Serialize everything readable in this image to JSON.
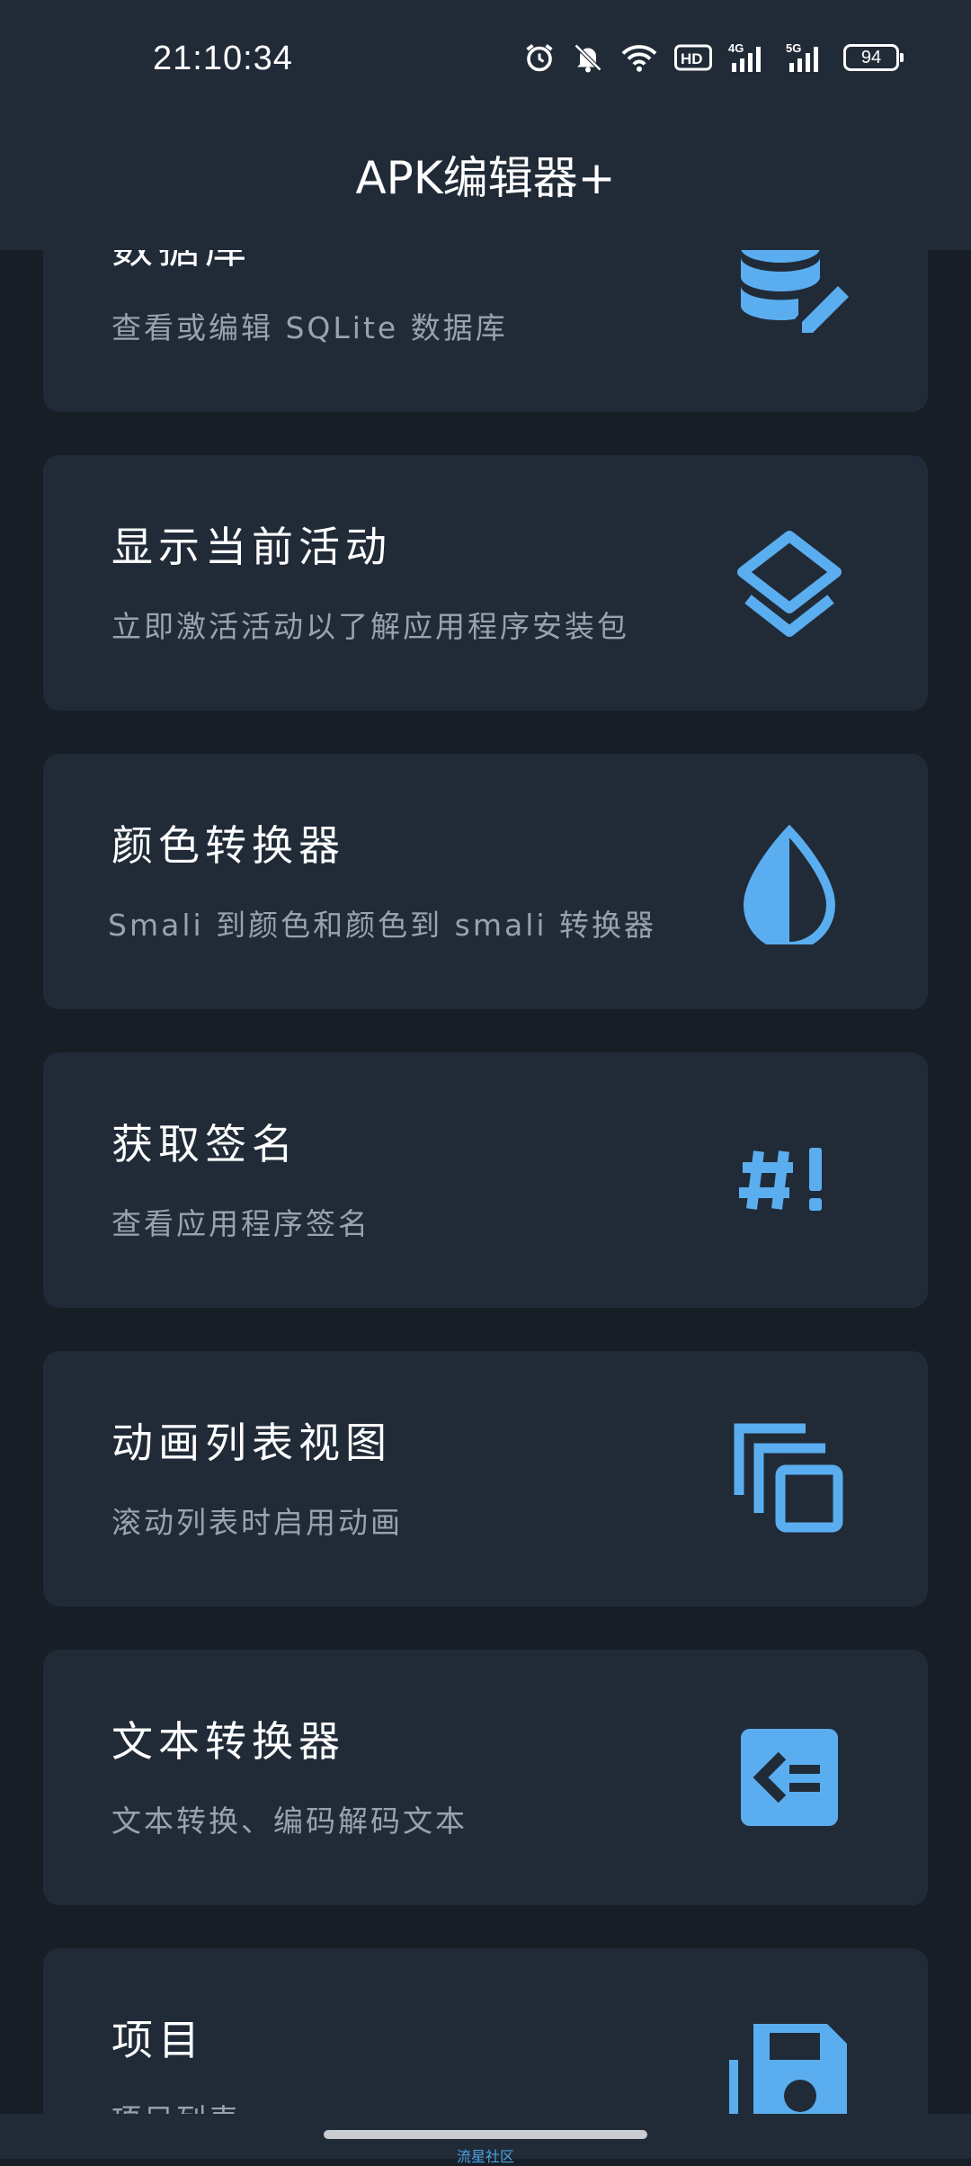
{
  "status_bar": {
    "time": "21:10:34",
    "battery": "94",
    "network_1": "4G",
    "network_2": "5G",
    "hd": "HD"
  },
  "app_bar": {
    "title": "APK编辑器+"
  },
  "colors": {
    "accent": "#5aaef0",
    "card_bg": "#212b38",
    "page_bg": "#181e26"
  },
  "cards": [
    {
      "title": "数据库",
      "desc": "查看或编辑 SQLite 数据库",
      "icon": "database-edit-icon"
    },
    {
      "title": "显示当前活动",
      "desc": "立即激活活动以了解应用程序安装包",
      "icon": "layers-icon"
    },
    {
      "title": "颜色转换器",
      "desc": "Smali 到颜色和颜色到 smali 转换器",
      "icon": "color-drop-icon"
    },
    {
      "title": "获取签名",
      "desc": "查看应用程序签名",
      "icon": "hash-exclamation-icon"
    },
    {
      "title": "动画列表视图",
      "desc": "滚动列表时启用动画",
      "icon": "copy-stack-icon"
    },
    {
      "title": "文本转换器",
      "desc": "文本转换、编码解码文本",
      "icon": "text-convert-icon"
    },
    {
      "title": "项目",
      "desc": "项目列表",
      "icon": "save-floppy-icon"
    }
  ],
  "watermark": "流星社区"
}
